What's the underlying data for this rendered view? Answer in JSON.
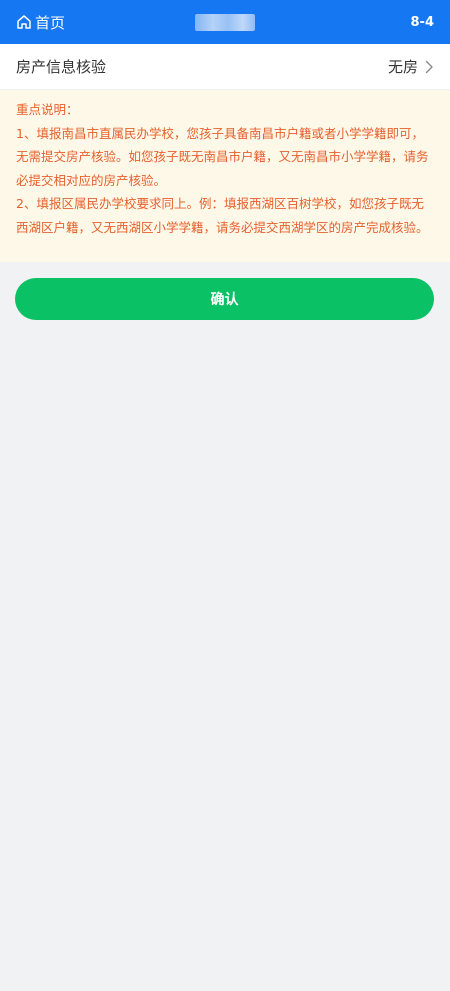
{
  "header": {
    "home_label": "首页",
    "home_icon": "home-icon",
    "code": "8-4",
    "background_color": "#1677f2"
  },
  "house_row": {
    "label": "房产信息核验",
    "value": "无房",
    "icon": "chevron-right-icon"
  },
  "notice": {
    "title": "重点说明：",
    "paragraphs": [
      "1、填报南昌市直属民办学校，您孩子具备南昌市户籍或者小学学籍即可，无需提交房产核验。如您孩子既无南昌市户籍，又无南昌市小学学籍，请务必提交相对应的房产核验。",
      "2、填报区属民办学校要求同上。例：填报西湖区百树学校，如您孩子既无西湖区户籍，又无西湖区小学学籍，请务必提交西湖学区的房产完成核验。"
    ],
    "text_color": "#e6612e",
    "background_color": "#fef8e8"
  },
  "confirm": {
    "label": "确认",
    "color": "#0ac165"
  }
}
